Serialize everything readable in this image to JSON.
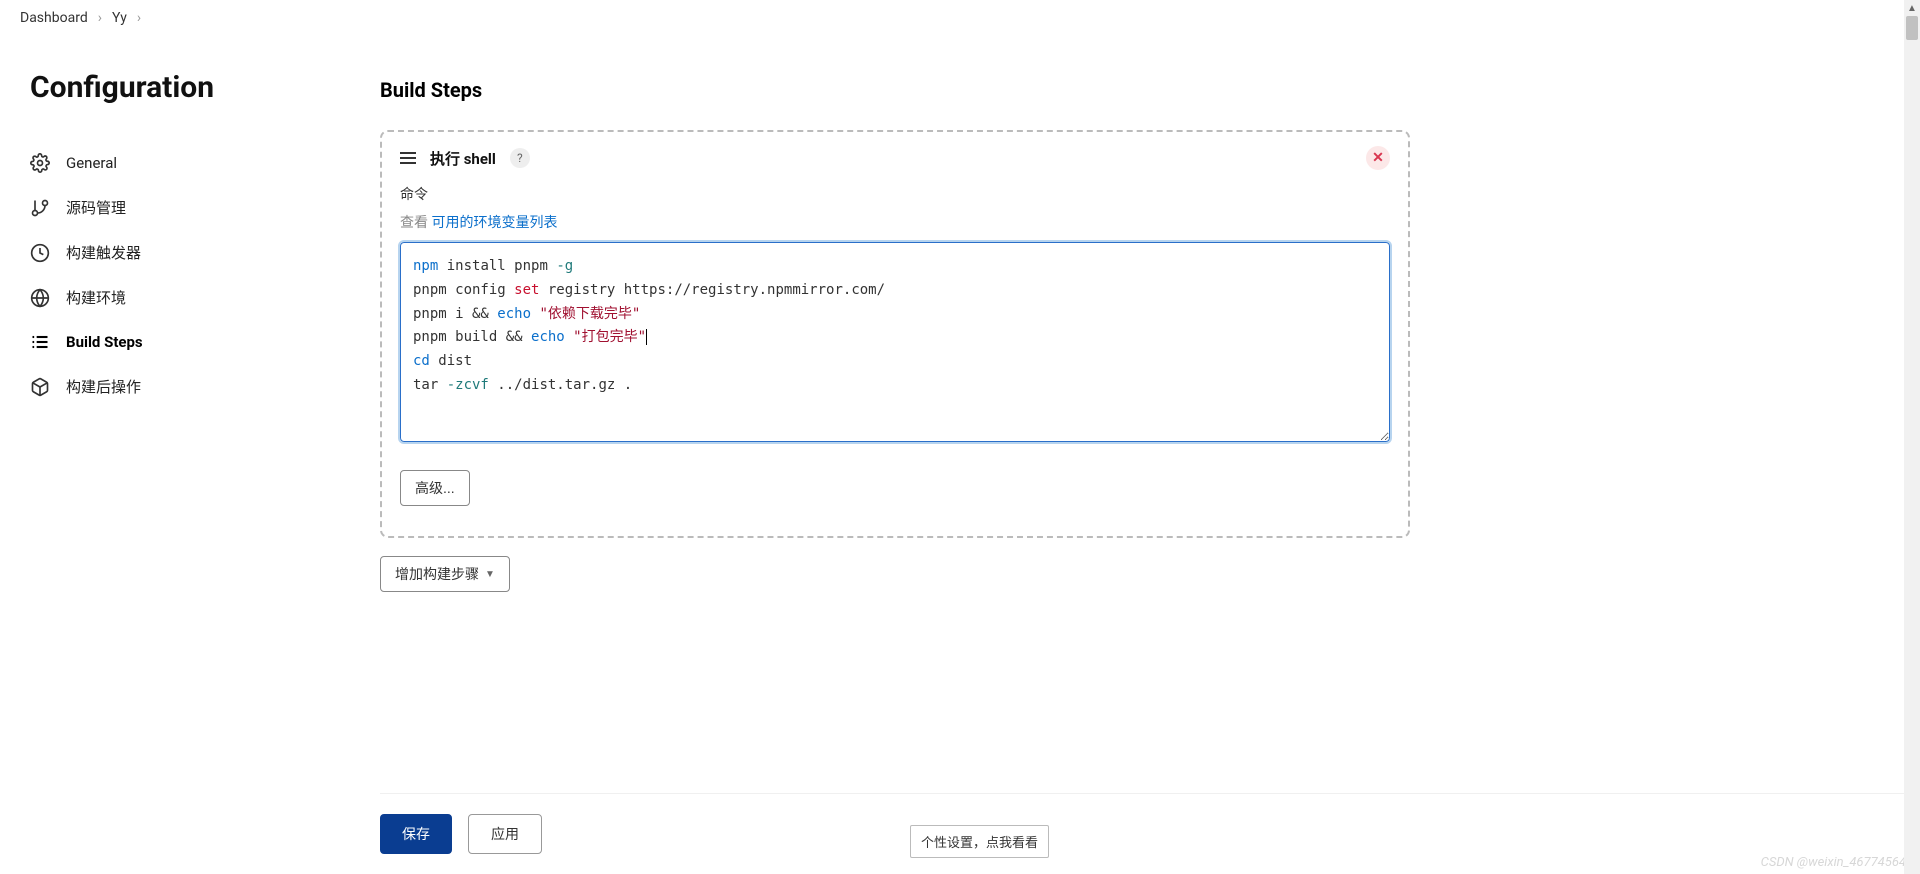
{
  "breadcrumb": {
    "items": [
      "Dashboard",
      "Yy"
    ]
  },
  "sidebar": {
    "title": "Configuration",
    "items": [
      {
        "label": "General"
      },
      {
        "label": "源码管理"
      },
      {
        "label": "构建触发器"
      },
      {
        "label": "构建环境"
      },
      {
        "label": "Build Steps"
      },
      {
        "label": "构建后操作"
      }
    ]
  },
  "section": {
    "title": "Build Steps"
  },
  "step": {
    "title": "执行 shell",
    "help": "?",
    "field_label": "命令",
    "help_prefix": "查看 ",
    "help_link": "可用的环境变量列表",
    "code_tokens": [
      {
        "t": "npm",
        "c": "kw-blue"
      },
      {
        "t": " install pnpm "
      },
      {
        "t": "-g",
        "c": "kw-teal"
      },
      {
        "t": "\n"
      },
      {
        "t": "pnpm config "
      },
      {
        "t": "set",
        "c": "kw-red"
      },
      {
        "t": " registry https://registry.npmmirror.com/\n"
      },
      {
        "t": "pnpm i && "
      },
      {
        "t": "echo",
        "c": "kw-blue"
      },
      {
        "t": " "
      },
      {
        "t": "\"依赖下载完毕\"",
        "c": "kw-dkred"
      },
      {
        "t": "\n"
      },
      {
        "t": "pnpm build && "
      },
      {
        "t": "echo",
        "c": "kw-blue"
      },
      {
        "t": " "
      },
      {
        "t": "\"打包完毕\"",
        "c": "kw-dkred"
      },
      {
        "t": "",
        "cursor": true
      },
      {
        "t": "\n"
      },
      {
        "t": "cd",
        "c": "kw-blue"
      },
      {
        "t": " dist\n"
      },
      {
        "t": "tar "
      },
      {
        "t": "-zcvf",
        "c": "kw-teal"
      },
      {
        "t": " ../dist.tar.gz ."
      }
    ],
    "advanced_btn": "高级..."
  },
  "add_step_btn": "增加构建步骤",
  "footer": {
    "save": "保存",
    "apply": "应用"
  },
  "popup_hint": "个性设置，点我看看",
  "watermark": "CSDN @weixin_46774564"
}
